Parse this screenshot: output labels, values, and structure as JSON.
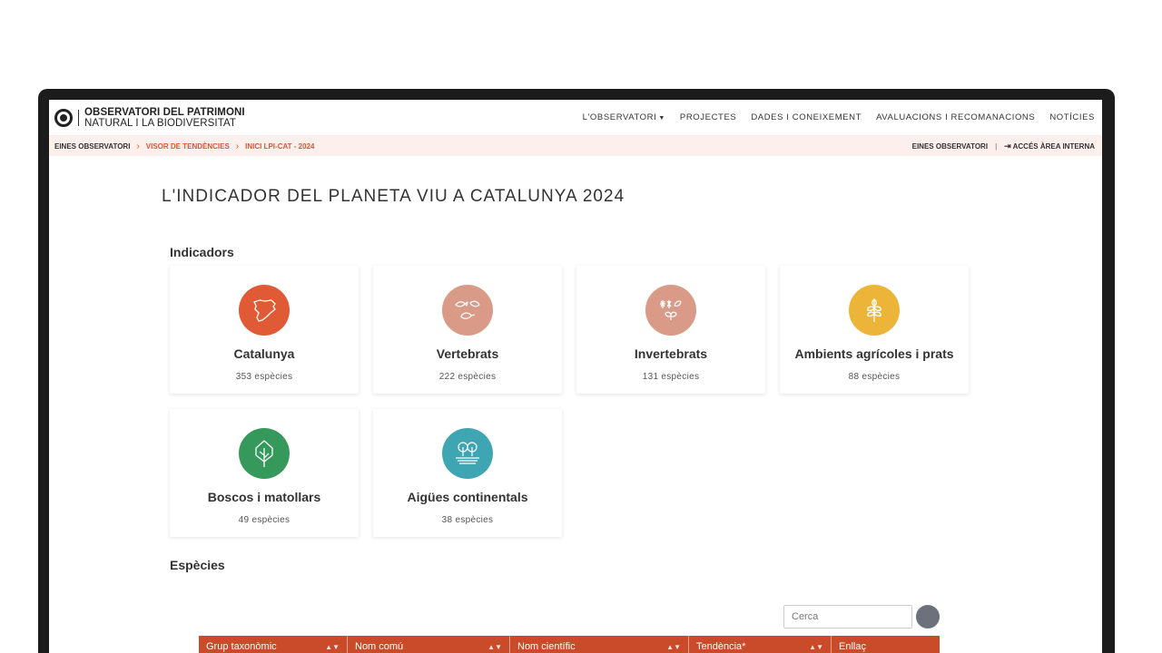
{
  "header": {
    "logo_line1": "OBSERVATORI DEL PATRIMONI",
    "logo_line2": "NATURAL I LA BIODIVERSITAT",
    "nav": [
      "L'OBSERVATORI",
      "PROJECTES",
      "DADES I CONEIXEMENT",
      "AVALUACIONS I RECOMANACIONS",
      "NOTÍCIES"
    ]
  },
  "breadcrumb": {
    "items": [
      "EINES OBSERVATORI",
      "VISOR DE TENDÈNCIES",
      "INICI LPI-CAT - 2024"
    ],
    "right_link": "EINES OBSERVATORI",
    "login": "ACCÉS ÀREA INTERNA"
  },
  "page": {
    "title": "L'INDICADOR DEL PLANETA VIU A CATALUNYA 2024",
    "indicators_heading": "Indicadors",
    "species_heading": "Espècies"
  },
  "indicators": [
    {
      "name": "Catalunya",
      "count": "353 espècies",
      "color": "#e05a36",
      "icon": "catalonia-map-icon"
    },
    {
      "name": "Vertebrats",
      "count": "222 espècies",
      "color": "#d99a87",
      "icon": "vertebrates-icon"
    },
    {
      "name": "Invertebrats",
      "count": "131 espècies",
      "color": "#d99a87",
      "icon": "invertebrates-icon"
    },
    {
      "name": "Ambients agrícoles i prats",
      "count": "88 espècies",
      "color": "#ecb53a",
      "icon": "wheat-icon"
    },
    {
      "name": "Boscos i matollars",
      "count": "49 espècies",
      "color": "#35995c",
      "icon": "tree-icon"
    },
    {
      "name": "Aigües continentals",
      "count": "38 espècies",
      "color": "#3ea6b3",
      "icon": "water-trees-icon"
    }
  ],
  "search": {
    "placeholder": "Cerca"
  },
  "table": {
    "columns": [
      "Grup taxonòmic",
      "Nom comú",
      "Nom científic",
      "Tendència*",
      "Enllaç"
    ]
  }
}
